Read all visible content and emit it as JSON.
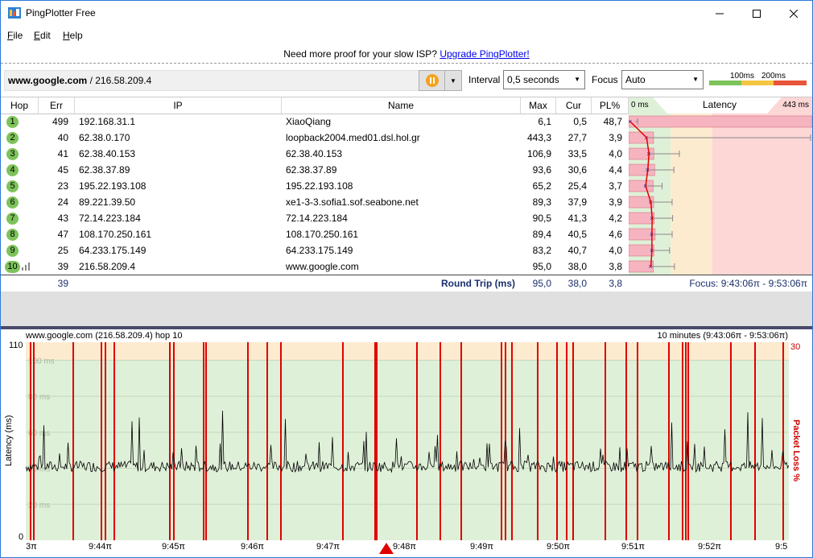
{
  "window": {
    "title": "PingPlotter Free"
  },
  "menu": {
    "file": "File",
    "file_key": "F",
    "file_rest": "ile",
    "edit": "Edit",
    "edit_key": "E",
    "edit_rest": "dit",
    "help": "Help",
    "help_key": "H",
    "help_rest": "elp"
  },
  "promo": {
    "text": "Need more proof for your slow ISP?",
    "link": "Upgrade PingPlotter!"
  },
  "toolbar": {
    "target_host": "www.google.com",
    "target_ip": " / 216.58.209.4",
    "interval_label": "Interval",
    "interval_value": "0,5 seconds",
    "focus_label": "Focus",
    "focus_value": "Auto",
    "legend_100": "100ms",
    "legend_200": "200ms"
  },
  "table": {
    "headers": {
      "hop": "Hop",
      "err": "Err",
      "ip": "IP",
      "name": "Name",
      "max": "Max",
      "cur": "Cur",
      "pl": "PL%",
      "latency_min": "0 ms",
      "latency": "Latency",
      "latency_max": "443 ms"
    },
    "rows": [
      {
        "hop": "1",
        "err": "499",
        "ip": "192.168.31.1",
        "name": "XiaoQiang",
        "max": "6,1",
        "cur": "0,5",
        "pl": "48,7"
      },
      {
        "hop": "2",
        "err": "40",
        "ip": "62.38.0.170",
        "name": "loopback2004.med01.dsl.hol.gr",
        "max": "443,3",
        "cur": "27,7",
        "pl": "3,9"
      },
      {
        "hop": "3",
        "err": "41",
        "ip": "62.38.40.153",
        "name": "62.38.40.153",
        "max": "106,9",
        "cur": "33,5",
        "pl": "4,0"
      },
      {
        "hop": "4",
        "err": "45",
        "ip": "62.38.37.89",
        "name": "62.38.37.89",
        "max": "93,6",
        "cur": "30,6",
        "pl": "4,4"
      },
      {
        "hop": "5",
        "err": "23",
        "ip": "195.22.193.108",
        "name": "195.22.193.108",
        "max": "65,2",
        "cur": "25,4",
        "pl": "3,7"
      },
      {
        "hop": "6",
        "err": "24",
        "ip": "89.221.39.50",
        "name": "xe1-3-3.sofia1.sof.seabone.net",
        "max": "89,3",
        "cur": "37,9",
        "pl": "3,9"
      },
      {
        "hop": "7",
        "err": "43",
        "ip": "72.14.223.184",
        "name": "72.14.223.184",
        "max": "90,5",
        "cur": "41,3",
        "pl": "4,2"
      },
      {
        "hop": "8",
        "err": "47",
        "ip": "108.170.250.161",
        "name": "108.170.250.161",
        "max": "89,4",
        "cur": "40,5",
        "pl": "4,6"
      },
      {
        "hop": "9",
        "err": "25",
        "ip": "64.233.175.149",
        "name": "64.233.175.149",
        "max": "83,2",
        "cur": "40,7",
        "pl": "4,0"
      },
      {
        "hop": "10",
        "err": "39",
        "ip": "216.58.209.4",
        "name": "www.google.com",
        "max": "95,0",
        "cur": "38,0",
        "pl": "3,8"
      }
    ],
    "round_trip": {
      "err": "39",
      "label": "Round Trip (ms)",
      "max": "95,0",
      "cur": "38,0",
      "pl": "3,8",
      "focus": "Focus: 9:43:06π - 9:53:06π"
    }
  },
  "graph": {
    "title_left": "www.google.com (216.58.209.4) hop 10",
    "title_right": "10 minutes (9:43:06π - 9:53:06π)",
    "y_max_label": "110",
    "y_zero_label": "0",
    "pl_max_label": "30",
    "y_axis_title": "Latency (ms)",
    "pl_axis_title": "Packet Loss %",
    "grid_labels": [
      "100 ms",
      "80 ms",
      "60 ms",
      "40 ms",
      "20 ms"
    ],
    "x_labels": [
      "3π",
      "9:44π",
      "9:45π",
      "9:46π",
      "9:47π",
      "9:48π",
      "9:49π",
      "9:50π",
      "9:51π",
      "9:52π",
      "9:5"
    ],
    "colors": {
      "good": "#dff0d8",
      "warn": "#fdebd0",
      "bad": "#fdd6d6",
      "loss": "#e00000"
    }
  }
}
